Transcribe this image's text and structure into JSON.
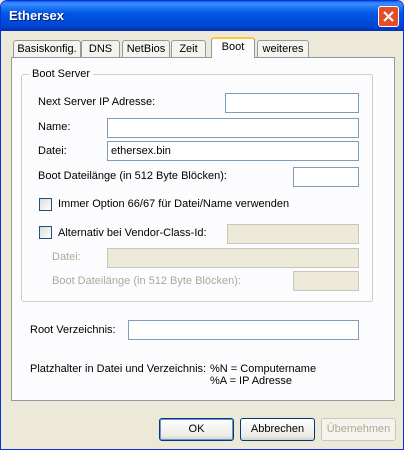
{
  "window": {
    "title": "Ethersex"
  },
  "tabs": [
    {
      "label": "Basiskonfig."
    },
    {
      "label": "DNS"
    },
    {
      "label": "NetBios"
    },
    {
      "label": "Zeit"
    },
    {
      "label": "Boot"
    },
    {
      "label": "weiteres"
    }
  ],
  "active_tab": "Boot",
  "boot_server": {
    "group_label": "Boot Server",
    "next_server_label": "Next Server IP Adresse:",
    "next_server_value": "",
    "name_label": "Name:",
    "name_value": "",
    "datei_label": "Datei:",
    "datei_value": "ethersex.bin",
    "boot_size_label": "Boot Dateilänge (in 512 Byte Blöcken):",
    "boot_size_value": "",
    "option_checkbox_label": "Immer Option 66/67 für Datei/Name verwenden",
    "option_checked": false,
    "vendor_checkbox_label": "Alternativ bei Vendor-Class-Id:",
    "vendor_checked": false,
    "vendor_value": "",
    "alt_datei_label": "Datei:",
    "alt_datei_value": "",
    "alt_boot_size_label": "Boot Dateilänge (in 512 Byte Blöcken):",
    "alt_boot_size_value": ""
  },
  "root": {
    "label": "Root Verzeichnis:",
    "value": ""
  },
  "placeholders": {
    "label": "Platzhalter in Datei und Verzeichnis:",
    "line1": "%N = Computername",
    "line2": "%A = IP Adresse"
  },
  "buttons": {
    "ok": "OK",
    "cancel": "Abbrechen",
    "apply": "Übernehmen"
  }
}
